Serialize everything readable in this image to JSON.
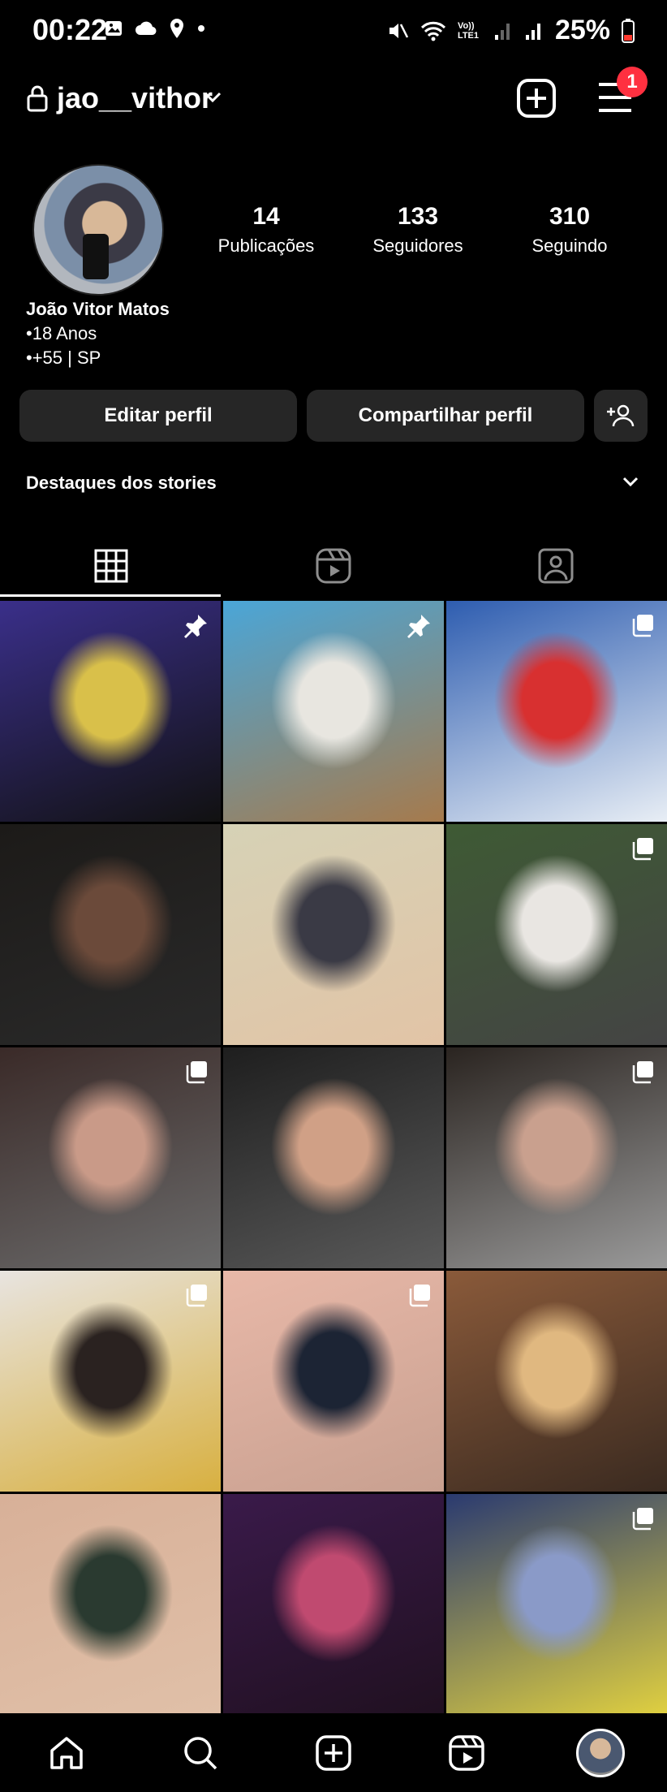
{
  "status_bar": {
    "time": "00:22",
    "battery": "25%",
    "network_label": "Vo)) LTE1"
  },
  "header": {
    "username": "jao__vithor",
    "notification_count": "1"
  },
  "profile": {
    "stats": [
      {
        "value": "14",
        "label": "Publicações"
      },
      {
        "value": "133",
        "label": "Seguidores"
      },
      {
        "value": "310",
        "label": "Seguindo"
      }
    ],
    "full_name": "João Vitor Matos",
    "bio_line1": "•18 Anos",
    "bio_line2": "•+55 | SP"
  },
  "actions": {
    "edit_label": "Editar perfil",
    "share_label": "Compartilhar perfil"
  },
  "highlights_label": "Destaques dos stories",
  "tabs": [
    {
      "icon": "grid-icon",
      "active": true
    },
    {
      "icon": "reels-icon",
      "active": false
    },
    {
      "icon": "tagged-icon",
      "active": false
    }
  ],
  "posts": [
    {
      "badge": "pin-icon",
      "colors": [
        "#3a2f8a",
        "#d9c04a",
        "#111"
      ]
    },
    {
      "badge": "pin-icon",
      "colors": [
        "#4aa6d8",
        "#e8e6e0",
        "#a67a4c"
      ]
    },
    {
      "badge": "multi-icon",
      "colors": [
        "#2e5db0",
        "#d83030",
        "#e8eef5"
      ]
    },
    {
      "badge": "",
      "colors": [
        "#1c1a18",
        "#6b4a3a",
        "#2a2a2a"
      ]
    },
    {
      "badge": "",
      "colors": [
        "#d6d2b6",
        "#3a3a45",
        "#e2c4a6"
      ]
    },
    {
      "badge": "multi-icon",
      "colors": [
        "#3e5a34",
        "#e9e6e2",
        "#444"
      ]
    },
    {
      "badge": "multi-icon",
      "colors": [
        "#3a2a28",
        "#c99a88",
        "#6b6b6b"
      ]
    },
    {
      "badge": "",
      "colors": [
        "#1e1e1e",
        "#d0a086",
        "#5a5a5a"
      ]
    },
    {
      "badge": "multi-icon",
      "colors": [
        "#2a2420",
        "#c9a08e",
        "#9a9a9a"
      ]
    },
    {
      "badge": "multi-icon",
      "colors": [
        "#e8e4e0",
        "#2a2220",
        "#d8b040"
      ]
    },
    {
      "badge": "multi-icon",
      "colors": [
        "#e8b8a8",
        "#1c2434",
        "#c8a090"
      ]
    },
    {
      "badge": "",
      "colors": [
        "#8a5a3a",
        "#e0b880",
        "#3a2a20"
      ]
    },
    {
      "badge": "",
      "colors": [
        "#d8b098",
        "#2a3a30",
        "#e0c0a8"
      ]
    },
    {
      "badge": "",
      "colors": [
        "#3a1a4a",
        "#c04a70",
        "#201020"
      ]
    },
    {
      "badge": "multi-icon",
      "colors": [
        "#2a3a70",
        "#8a9ac8",
        "#e0d040"
      ]
    }
  ],
  "bottom_nav": [
    "home-icon",
    "search-icon",
    "create-icon",
    "reels-icon",
    "profile-avatar"
  ]
}
